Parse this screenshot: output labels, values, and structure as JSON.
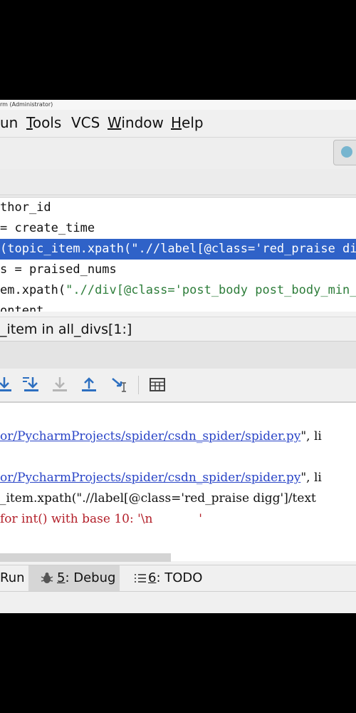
{
  "window": {
    "title": "rm (Administrator)"
  },
  "menu": {
    "run": {
      "label": "un",
      "mnemonic": "R"
    },
    "tools": {
      "mnemonic": "T",
      "rest": "ools"
    },
    "vcs": {
      "label": "VCS"
    },
    "window": {
      "mnemonic": "W",
      "rest": "indow"
    },
    "help": {
      "mnemonic": "H",
      "rest": "elp"
    }
  },
  "editor": {
    "line1": "thor_id",
    "line2": "= create_time",
    "line3": {
      "a": "(topic_item.xpath(",
      "s": "\".//label[@class='red_praise dig",
      "b": ""
    },
    "line4": "s = praised_nums",
    "line5": {
      "a": "em.xpath(",
      "s": "\".//div[@class='post_body post_body_min_"
    },
    "line6": "ontent"
  },
  "breadcrumb": {
    "text": "_item in all_divs[1:]"
  },
  "console": {
    "line1": {
      "link": "or/PycharmProjects/spider/csdn_spider/spider.py",
      "rest": "\", li"
    },
    "line2": {
      "link": "or/PycharmProjects/spider/csdn_spider/spider.py",
      "rest": "\", li"
    },
    "line3": "_item.xpath(\".//label[@class='red_praise digg']/text",
    "line4": "for int() with base 10: '\\n            '"
  },
  "bottom_tabs": {
    "run": "Run",
    "debug": {
      "num": "5",
      "label": ": Debug"
    },
    "todo": {
      "num": "6",
      "label": ": TODO"
    }
  },
  "colors": {
    "selection": "#2f62c8",
    "string": "#2d7d3a",
    "link": "#2a45c7",
    "error": "#b3202a"
  }
}
